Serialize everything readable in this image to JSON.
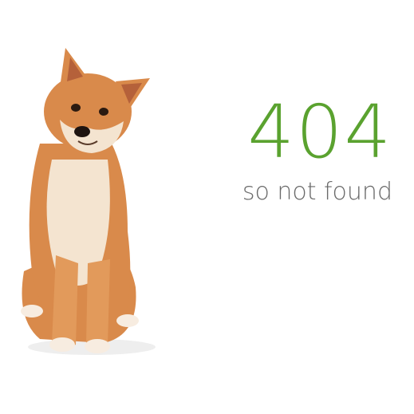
{
  "error": {
    "code": "404",
    "message": "so not found"
  },
  "illustration": {
    "subject": "shiba-inu-dog",
    "icon": "dog-photo"
  },
  "colors": {
    "accent": "#5aa22f",
    "message_text": "#6a6a6a",
    "background": "#ffffff",
    "dog_fur": "#d98a4b",
    "dog_cream": "#f4e4d0"
  }
}
